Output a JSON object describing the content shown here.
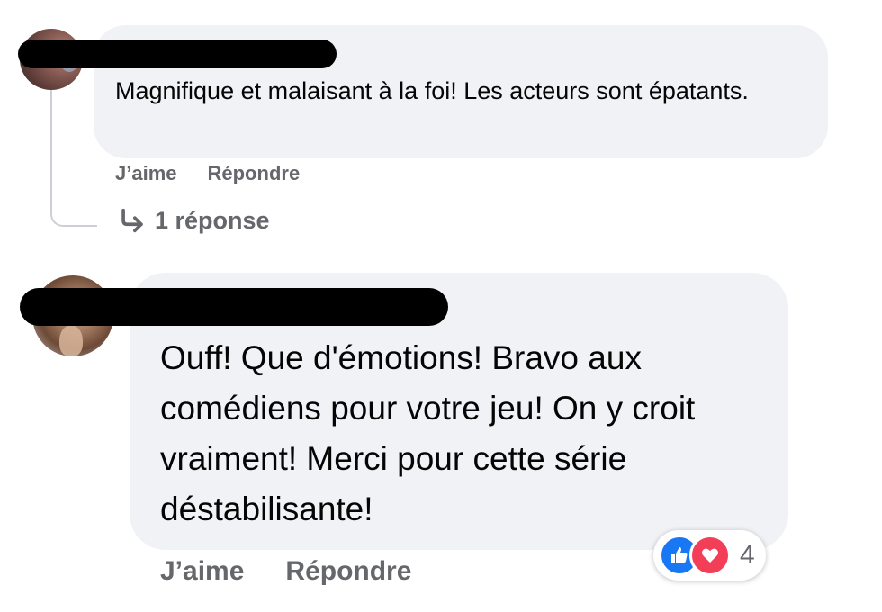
{
  "comments": [
    {
      "author": "",
      "text": "Magnifique et malaisant à la foi! Les acteurs sont épatants.",
      "like_label": "J’aime",
      "reply_label": "Répondre",
      "replies_label": "1 réponse"
    },
    {
      "author": "",
      "text": "Ouff! Que d'émotions! Bravo aux comédiens pour votre jeu! On y croit vraiment! Merci pour cette série déstabilisante!",
      "like_label": "J’aime",
      "reply_label": "Répondre",
      "reactions": {
        "icons": [
          "thumbs-up-icon",
          "heart-icon"
        ],
        "count": "4"
      }
    }
  ],
  "colors": {
    "bubble": "#f0f2f5",
    "secondary_text": "#65676b",
    "like_blue": "#1877f2",
    "love_red": "#f33e58"
  }
}
